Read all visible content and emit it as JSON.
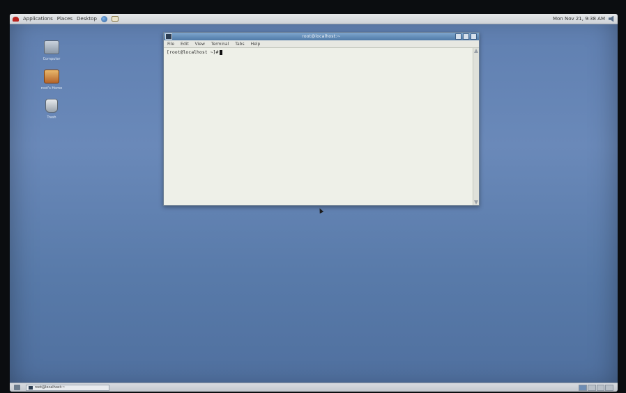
{
  "top_panel": {
    "menus": [
      {
        "label": "Applications"
      },
      {
        "label": "Places"
      },
      {
        "label": "Desktop"
      }
    ],
    "clock": "Mon Nov 21, 9:38 AM"
  },
  "desktop_icons": [
    {
      "label": "Computer",
      "kind": "computer-icon"
    },
    {
      "label": "root's Home",
      "kind": "home-folder-icon"
    },
    {
      "label": "Trash",
      "kind": "trash-icon"
    }
  ],
  "terminal": {
    "title": "root@localhost:~",
    "menu": [
      "File",
      "Edit",
      "View",
      "Terminal",
      "Tabs",
      "Help"
    ],
    "prompt": "[root@localhost ~]#"
  },
  "bottom_panel": {
    "task_label": "root@localhost:~",
    "workspaces": 4,
    "active_workspace": 1
  }
}
